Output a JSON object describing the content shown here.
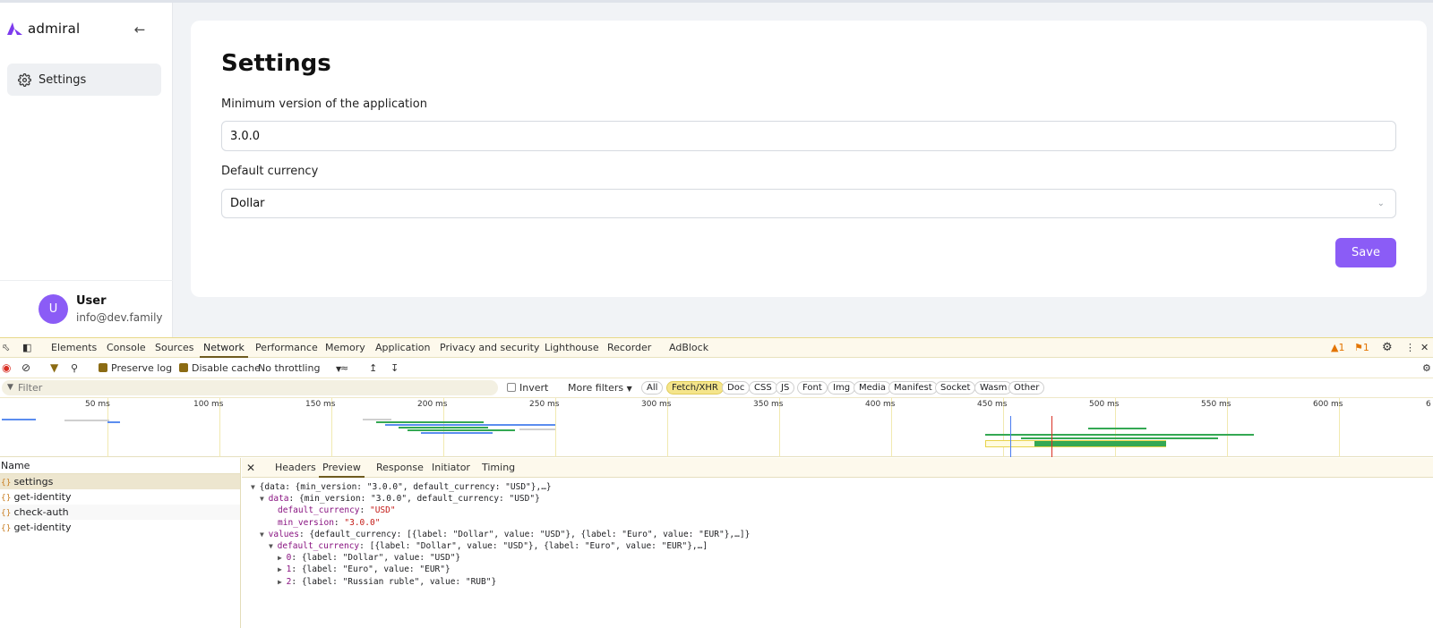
{
  "app": {
    "logo_text": "admiral",
    "sidebar": {
      "items": [
        {
          "label": "Settings"
        }
      ]
    },
    "user": {
      "initial": "U",
      "name": "User",
      "email": "info@dev.family"
    },
    "page": {
      "title": "Settings",
      "min_version_label": "Minimum version of the application",
      "min_version_value": "3.0.0",
      "currency_label": "Default currency",
      "currency_value": "Dollar",
      "save_label": "Save"
    }
  },
  "devtools": {
    "tabs": [
      "Elements",
      "Console",
      "Sources",
      "Network",
      "Performance",
      "Memory",
      "Application",
      "Privacy and security",
      "Lighthouse",
      "Recorder",
      "AdBlock"
    ],
    "active_tab": "Network",
    "warnings": "1",
    "issues": "1",
    "toolbar": {
      "preserve_log": "Preserve log",
      "disable_cache": "Disable cache",
      "throttling": "No throttling"
    },
    "filter": {
      "placeholder": "Filter",
      "invert": "Invert",
      "more_filters": "More filters"
    },
    "filter_chips": [
      "All",
      "Fetch/XHR",
      "Doc",
      "CSS",
      "JS",
      "Font",
      "Img",
      "Media",
      "Manifest",
      "Socket",
      "Wasm",
      "Other"
    ],
    "active_chip": "Fetch/XHR",
    "timeline_ticks": [
      "50 ms",
      "100 ms",
      "150 ms",
      "200 ms",
      "250 ms",
      "300 ms",
      "350 ms",
      "400 ms",
      "450 ms",
      "500 ms",
      "550 ms",
      "600 ms",
      "6"
    ],
    "requests_header": "Name",
    "requests": [
      "settings",
      "get-identity",
      "check-auth",
      "get-identity"
    ],
    "detail_tabs": [
      "Headers",
      "Preview",
      "Response",
      "Initiator",
      "Timing"
    ],
    "active_detail_tab": "Preview",
    "preview": {
      "root": "{data: {min_version: \"3.0.0\", default_currency: \"USD\"},…}",
      "data_key": "data",
      "data_summary": "{min_version: \"3.0.0\", default_currency: \"USD\"}",
      "default_currency_key": "default_currency",
      "default_currency_val": "\"USD\"",
      "min_version_key": "min_version",
      "min_version_val": "\"3.0.0\"",
      "values_key": "values",
      "values_summary": "{default_currency: [{label: \"Dollar\", value: \"USD\"}, {label: \"Euro\", value: \"EUR\"},…]}",
      "values_dc_key": "default_currency",
      "values_dc_summary": "[{label: \"Dollar\", value: \"USD\"}, {label: \"Euro\", value: \"EUR\"},…]",
      "items": [
        {
          "key": "0",
          "val": "{label: \"Dollar\", value: \"USD\"}"
        },
        {
          "key": "1",
          "val": "{label: \"Euro\", value: \"EUR\"}"
        },
        {
          "key": "2",
          "val": "{label: \"Russian ruble\", value: \"RUB\"}"
        }
      ]
    }
  }
}
